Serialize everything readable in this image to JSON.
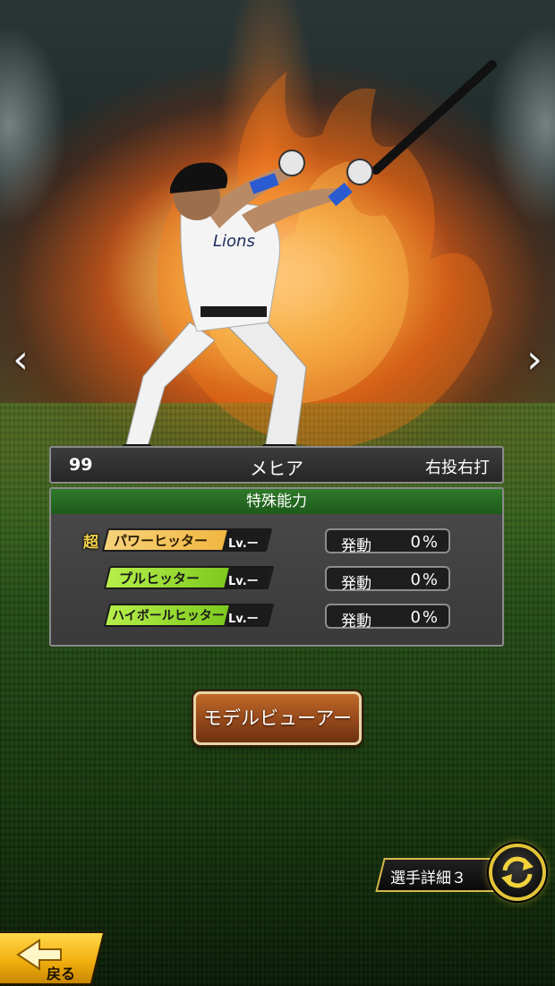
{
  "player": {
    "number": "99",
    "name": "メヒア",
    "throw_bat": "右投右打"
  },
  "abilities": {
    "header": "特殊能力",
    "items": [
      {
        "name": "パワーヒッター",
        "rank": "超",
        "level": "Lv.ー",
        "activate_label": "発動",
        "activate_pct": "0%",
        "color": "#f2b640"
      },
      {
        "name": "プルヒッター",
        "rank": "",
        "level": "Lv.ー",
        "activate_label": "発動",
        "activate_pct": "0%",
        "color": "#8ed62a"
      },
      {
        "name": "ハイボールヒッター",
        "rank": "",
        "level": "Lv.ー",
        "activate_label": "発動",
        "activate_pct": "0%",
        "color": "#8ed62a"
      }
    ]
  },
  "buttons": {
    "model_viewer": "モデルビューアー",
    "player_detail": "選手詳細３",
    "back": "戻る"
  },
  "icons": {
    "nav_left": "chevron-left-icon",
    "nav_right": "chevron-right-icon",
    "swap": "swap-arrows-icon",
    "back": "back-arrow-icon"
  },
  "colors": {
    "header_green": "#2f7a2a",
    "button_brown": "#93471a",
    "accent_gold": "#e2c238"
  }
}
